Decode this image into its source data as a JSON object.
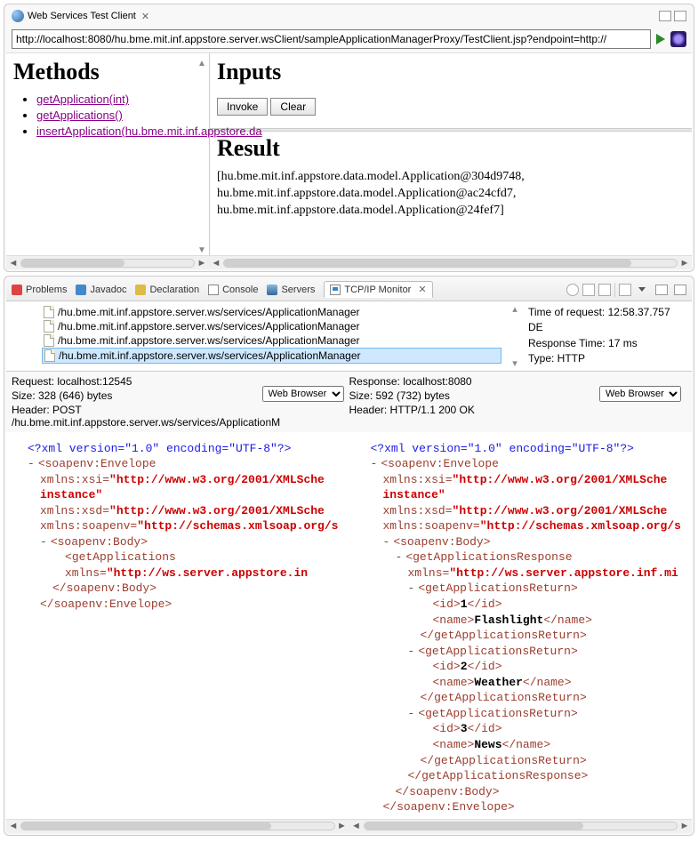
{
  "topPanel": {
    "title": "Web Services Test Client",
    "url": "http://localhost:8080/hu.bme.mit.inf.appstore.server.wsClient/sampleApplicationManagerProxy/TestClient.jsp?endpoint=http://",
    "methodsHeading": "Methods",
    "methods": [
      "getApplication(int)",
      "getApplications()",
      "insertApplication(hu.bme.mit.inf.appstore.da"
    ],
    "inputsHeading": "Inputs",
    "invokeLabel": "Invoke",
    "clearLabel": "Clear",
    "resultHeading": "Result",
    "resultText": "[hu.bme.mit.inf.appstore.data.model.Application@304d9748,\nhu.bme.mit.inf.appstore.data.model.Application@ac24cfd7,\nhu.bme.mit.inf.appstore.data.model.Application@24fef7]"
  },
  "bottomPanel": {
    "tabs": {
      "problems": "Problems",
      "javadoc": "Javadoc",
      "declaration": "Declaration",
      "console": "Console",
      "servers": "Servers",
      "monitor": "TCP/IP Monitor"
    },
    "requests": [
      "/hu.bme.mit.inf.appstore.server.ws/services/ApplicationManager",
      "/hu.bme.mit.inf.appstore.server.ws/services/ApplicationManager",
      "/hu.bme.mit.inf.appstore.server.ws/services/ApplicationManager",
      "/hu.bme.mit.inf.appstore.server.ws/services/ApplicationManager"
    ],
    "info": {
      "time": "Time of request: 12:58.37.757 DE",
      "resp": "Response Time: 17 ms",
      "type": "Type: HTTP"
    },
    "reqMeta": {
      "line1": "Request: localhost:12545",
      "line2": "Size: 328 (646) bytes",
      "line3": "Header: POST /hu.bme.mit.inf.appstore.server.ws/services/ApplicationM",
      "viewer": "Web Browser"
    },
    "resMeta": {
      "line1": "Response: localhost:8080",
      "line2": "Size: 592 (732) bytes",
      "line3": "Header: HTTP/1.1 200 OK",
      "viewer": "Web Browser"
    },
    "xmlCommon": {
      "decl": "<?xml version=\"1.0\" encoding=\"UTF-8\"?>",
      "envOpen": "soapenv:Envelope",
      "xsiAttr": "xmlns:xsi=",
      "xsiVal": "\"http://www.w3.org/2001/XMLSche",
      "instance": "instance\"",
      "xsdAttr": "xmlns:xsd=",
      "xsdVal": "\"http://www.w3.org/2001/XMLSche",
      "envAttr": "xmlns:soapenv=",
      "envVal": "\"http://schemas.xmlsoap.org/s",
      "bodyOpen": "<soapenv:Body>",
      "bodyClose": "</soapenv:Body>",
      "envClose": "</soapenv:Envelope>"
    },
    "reqXml": {
      "op": "getApplications",
      "ns": "\"http://ws.server.appstore.in"
    },
    "resXml": {
      "op": "getApplicationsResponse",
      "ns": "\"http://ws.server.appstore.inf.mi",
      "ret": "getApplicationsReturn",
      "items": [
        {
          "id": "1",
          "name": "Flashlight"
        },
        {
          "id": "2",
          "name": "Weather"
        },
        {
          "id": "3",
          "name": "News"
        }
      ]
    }
  }
}
